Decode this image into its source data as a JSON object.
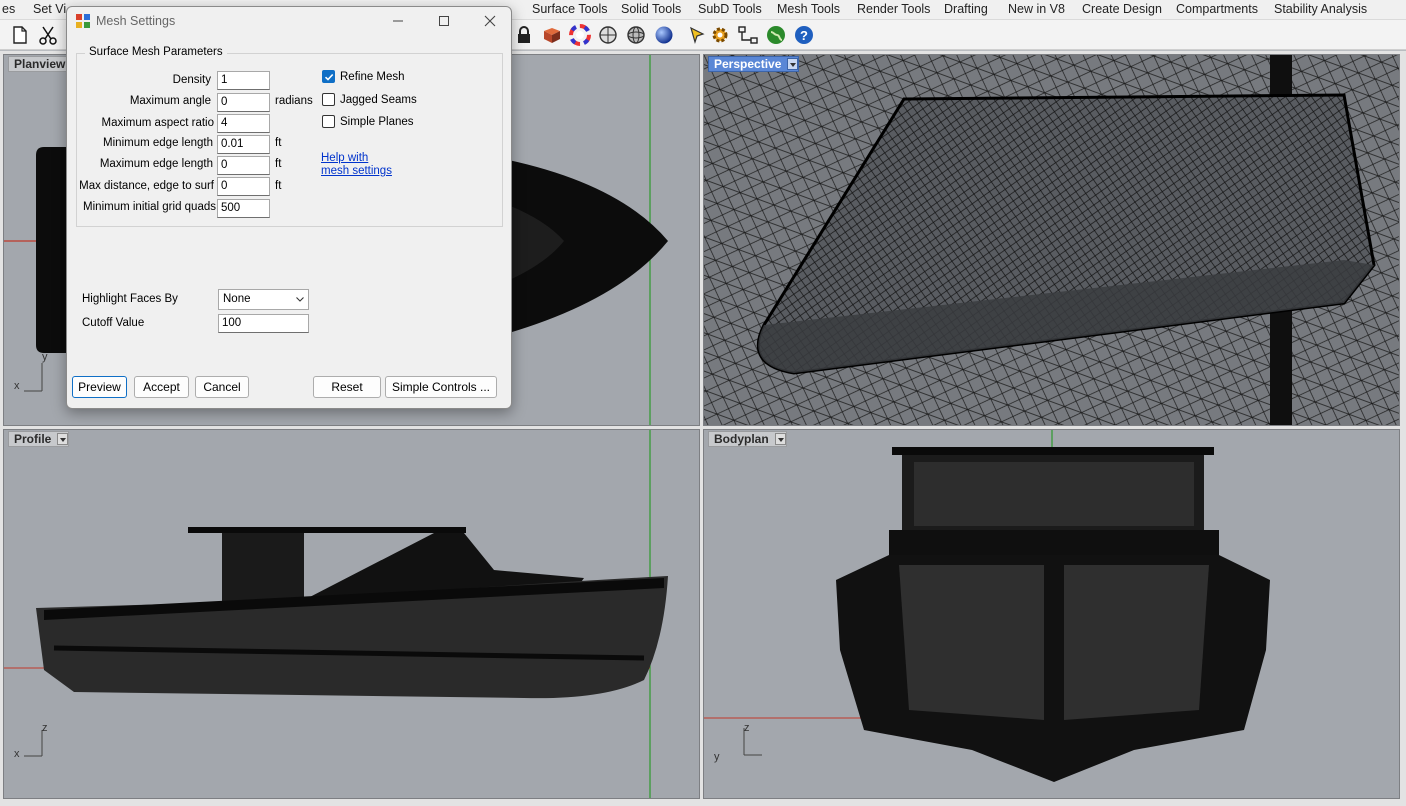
{
  "tabs": [
    "es",
    "Set Vi",
    "Surface Tools",
    "Solid Tools",
    "SubD Tools",
    "Mesh Tools",
    "Render Tools",
    "Drafting",
    "New in V8",
    "Create Design",
    "Compartments",
    "Stability Analysis"
  ],
  "toolbar": {
    "icons": [
      "new-document-icon",
      "cut-icon",
      "lock-icon",
      "material-icon",
      "color-wheel-icon",
      "sphere-icon",
      "wire-sphere-icon",
      "render-sphere-icon",
      "pen-icon",
      "settings-gear-icon",
      "network-icon",
      "globe-icon",
      "help-icon"
    ]
  },
  "viewports": {
    "planview": {
      "label": "Planview",
      "axis_h": "x",
      "axis_v": "y"
    },
    "perspective": {
      "label": "Perspective"
    },
    "profile": {
      "label": "Profile",
      "axis_h": "x",
      "axis_v": "z"
    },
    "bodyplan": {
      "label": "Bodyplan",
      "axis_h": "y",
      "axis_v": "z"
    }
  },
  "dialog": {
    "title": "Mesh Settings",
    "group_label": "Surface Mesh Parameters",
    "params": [
      {
        "label": "Density",
        "value": "1",
        "unit": ""
      },
      {
        "label": "Maximum angle",
        "value": "0",
        "unit": "radians"
      },
      {
        "label": "Maximum aspect ratio",
        "value": "4",
        "unit": ""
      },
      {
        "label": "Minimum edge length",
        "value": "0.01",
        "unit": "ft"
      },
      {
        "label": "Maximum edge length",
        "value": "0",
        "unit": "ft"
      },
      {
        "label": "Max distance, edge to surf",
        "value": "0",
        "unit": "ft"
      },
      {
        "label": "Minimum initial grid quads",
        "value": "500",
        "unit": ""
      }
    ],
    "checkboxes": [
      {
        "label": "Refine Mesh",
        "checked": true
      },
      {
        "label": "Jagged Seams",
        "checked": false
      },
      {
        "label": "Simple Planes",
        "checked": false
      }
    ],
    "help_link": [
      "Help with",
      "mesh settings"
    ],
    "highlight_label": "Highlight Faces By",
    "highlight_value": "None",
    "cutoff_label": "Cutoff Value",
    "cutoff_value": "100",
    "buttons": {
      "preview": "Preview",
      "accept": "Accept",
      "cancel": "Cancel",
      "reset": "Reset",
      "simple": "Simple Controls ..."
    }
  },
  "colors": {
    "viewport_bg": "#a3a7ad",
    "active_label": "#5a87d6",
    "axis_red": "#c0392b",
    "axis_green": "#2e9a2e",
    "accent": "#0f6fc6"
  }
}
